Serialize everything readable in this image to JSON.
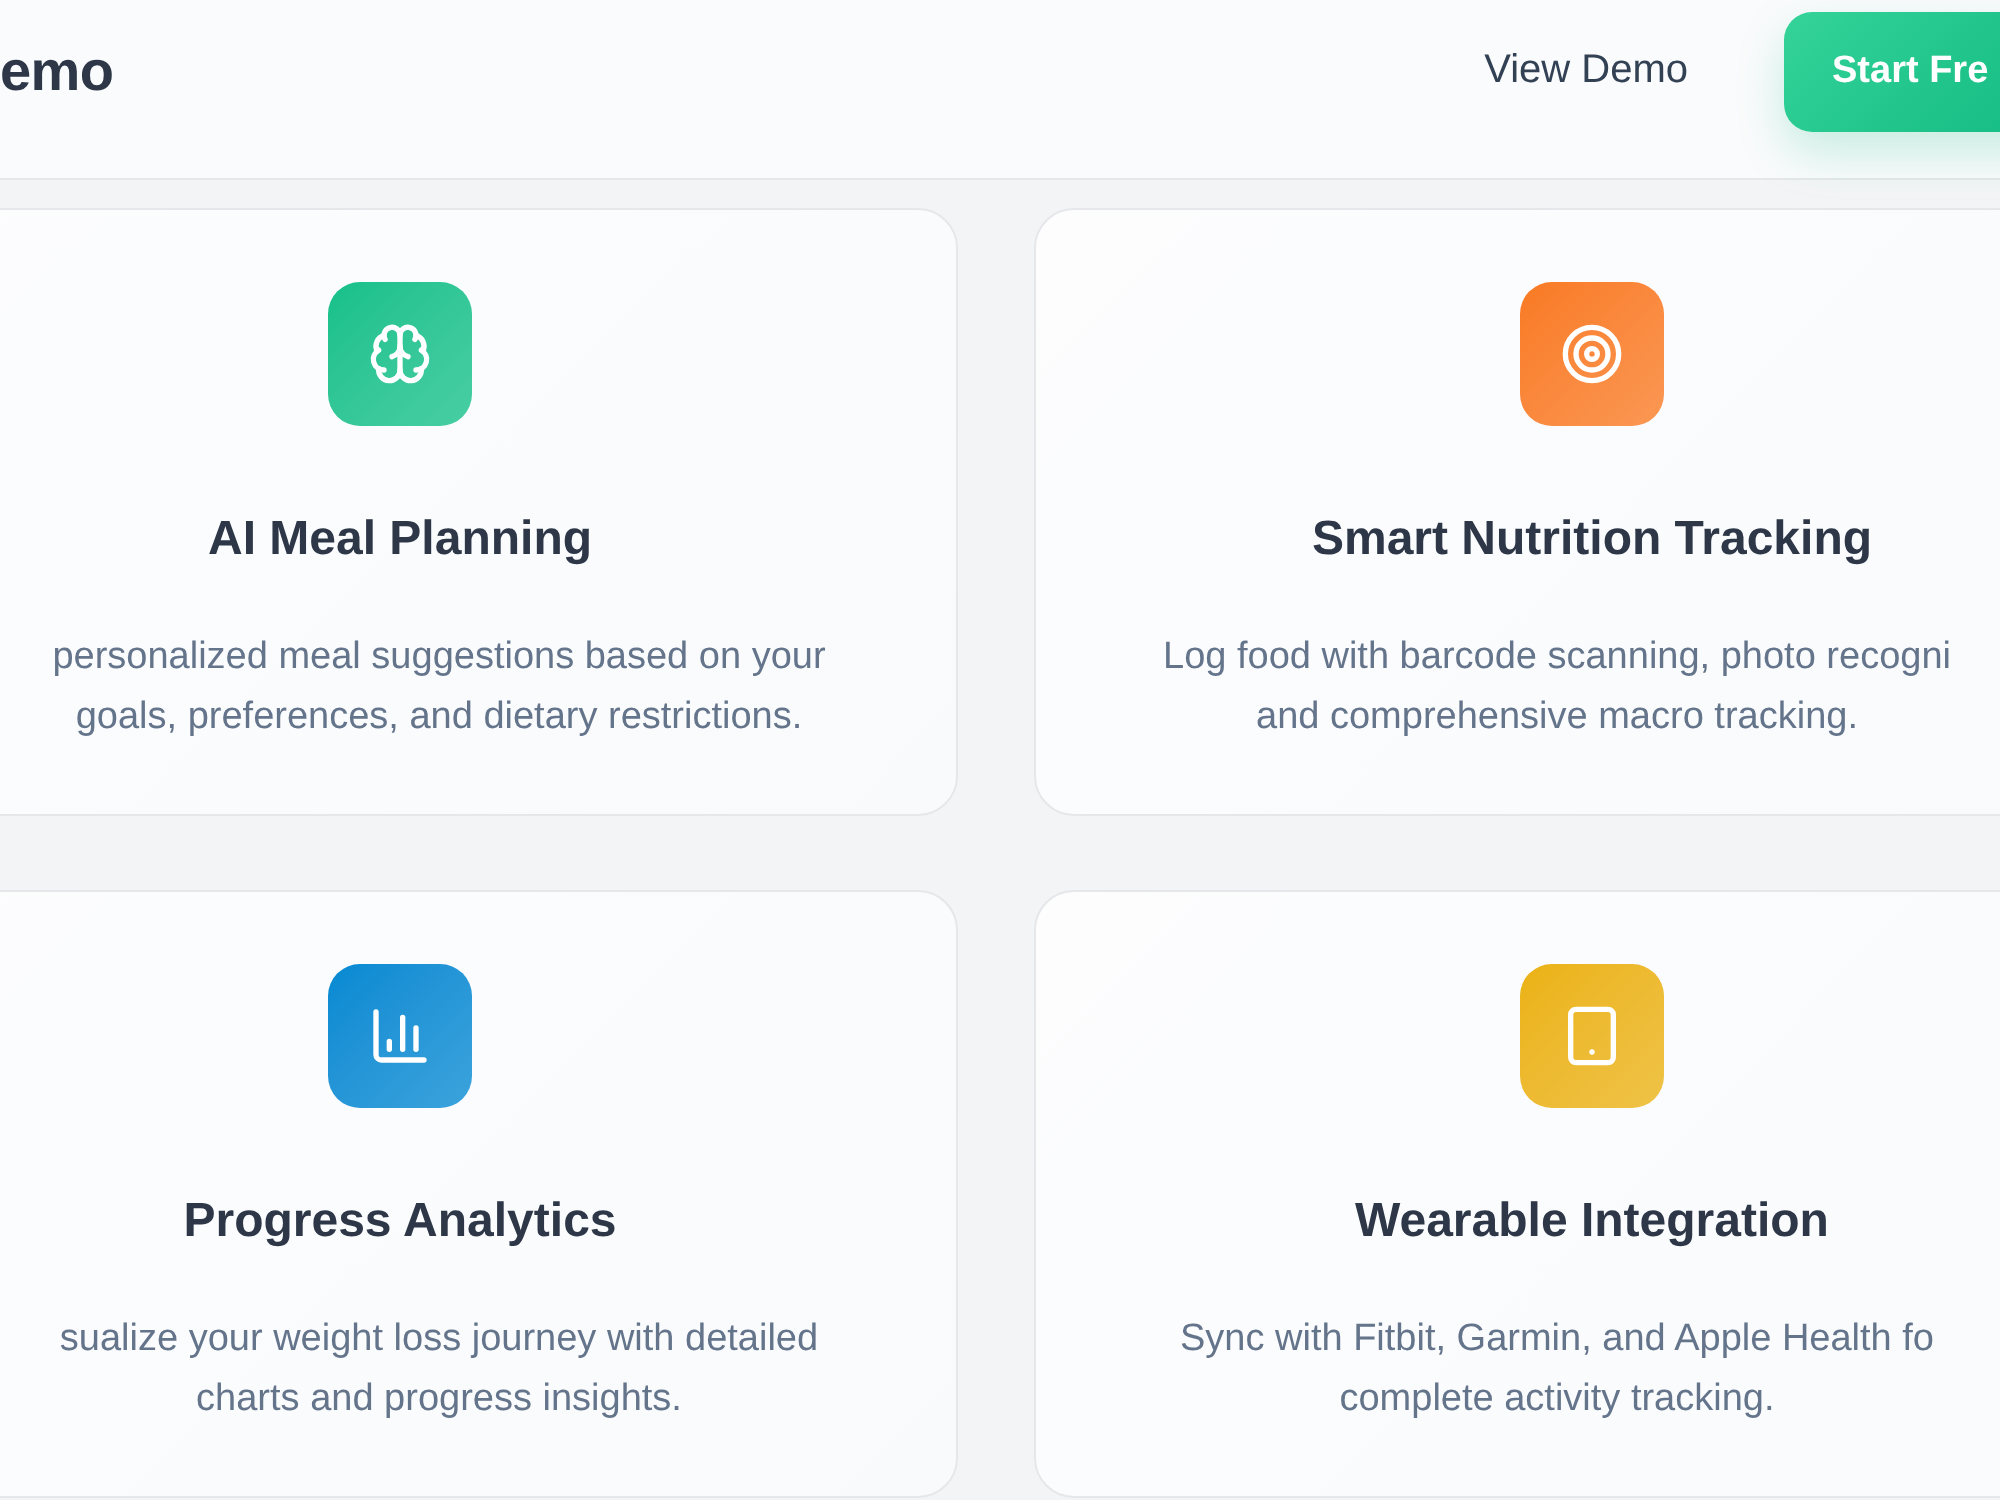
{
  "header": {
    "logo": "emo",
    "links": [
      {
        "label": "View Demo"
      }
    ],
    "cta": "Start Fre"
  },
  "features": [
    {
      "title": "AI Meal Planning",
      "description_lines": [
        "personalized meal suggestions based on your",
        "goals, preferences, and dietary restrictions."
      ],
      "color": "#14c08a"
    },
    {
      "title": "Smart Nutrition Tracking",
      "description_lines": [
        "Log food with barcode scanning, photo recogni",
        "and comprehensive macro tracking."
      ],
      "color": "#f97a22"
    },
    {
      "title": "Progress Analytics",
      "description_lines": [
        "sualize your weight loss journey with detailed",
        "charts and progress insights."
      ],
      "color": "#0389d2"
    },
    {
      "title": "Wearable Integration",
      "description_lines": [
        "Sync with Fitbit, Garmin, and Apple Health fo",
        "complete activity tracking."
      ],
      "color": "#ebb212"
    }
  ]
}
